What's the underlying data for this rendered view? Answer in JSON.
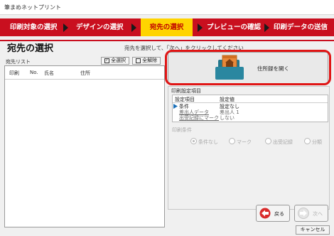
{
  "window": {
    "title": "筆まめネットプリント"
  },
  "steps": [
    {
      "label": "印刷対象の選択",
      "active": false
    },
    {
      "label": "デザインの選択",
      "active": false
    },
    {
      "label": "宛先の選択",
      "active": true
    },
    {
      "label": "プレビューの確認",
      "active": false
    },
    {
      "label": "印刷データの送信",
      "active": false
    }
  ],
  "page": {
    "title": "宛先の選択",
    "instruction": "宛先を選択して、「次へ」をクリックしてください"
  },
  "list": {
    "label": "宛先リスト",
    "select_all": "全選択",
    "deselect_all": "全解除",
    "columns": [
      "印刷",
      "No.",
      "氏名",
      "住所"
    ]
  },
  "open_address_book": {
    "label": "住所録を開く",
    "icon": "address-book-icon"
  },
  "print_settings": {
    "label": "印刷設定項目",
    "columns": [
      "設定項目",
      "設定値"
    ],
    "rows": [
      {
        "item": "条件",
        "value": "設定なし",
        "expanded": true
      },
      {
        "item": "差出人データ",
        "value": "差出人 1"
      },
      {
        "item": "出受記録にマーク",
        "value": "しない"
      }
    ]
  },
  "print_condition": {
    "label": "印刷条件",
    "options": [
      "条件なし",
      "マーク",
      "出受記録",
      "分類"
    ],
    "selected": "条件なし"
  },
  "nav": {
    "back": "戻る",
    "next": "次へ",
    "cancel": "キャンセル"
  },
  "colors": {
    "step_bar": "#c90f1f",
    "active_step": "#ffd400",
    "highlight": "#e01515",
    "back_button": "#d92b2b"
  }
}
